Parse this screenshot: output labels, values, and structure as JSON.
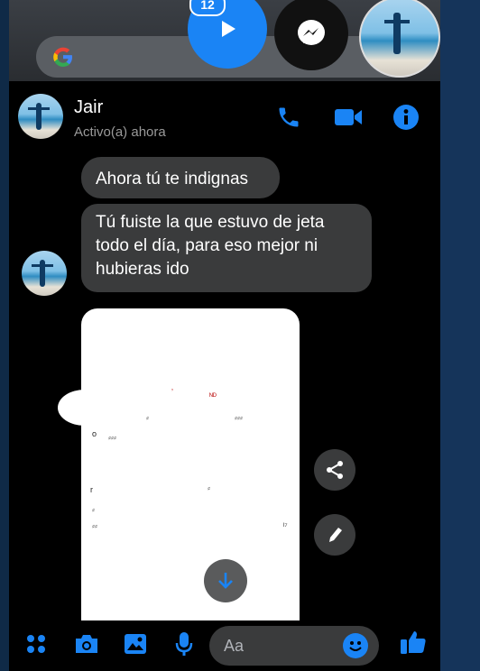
{
  "chat_heads": {
    "badge_count": "12"
  },
  "header": {
    "name": "Jair",
    "status": "Activo(a) ahora"
  },
  "messages": [
    {
      "text": "Ahora tú te indignas"
    },
    {
      "text": "Tú fuiste la que estuvo de jeta todo el día, para eso mejor ni hubieras ido"
    }
  ],
  "composer": {
    "placeholder": "Aa"
  },
  "colors": {
    "accent": "#1a84f5",
    "bubble": "#3a3b3c",
    "background": "#000000"
  },
  "icons": [
    "google-icon",
    "play-icon",
    "messenger-icon",
    "phone-icon",
    "video-icon",
    "info-icon",
    "share-icon",
    "edit-icon",
    "download-icon",
    "apps-icon",
    "camera-icon",
    "gallery-icon",
    "mic-icon",
    "emoji-icon",
    "like-icon"
  ]
}
